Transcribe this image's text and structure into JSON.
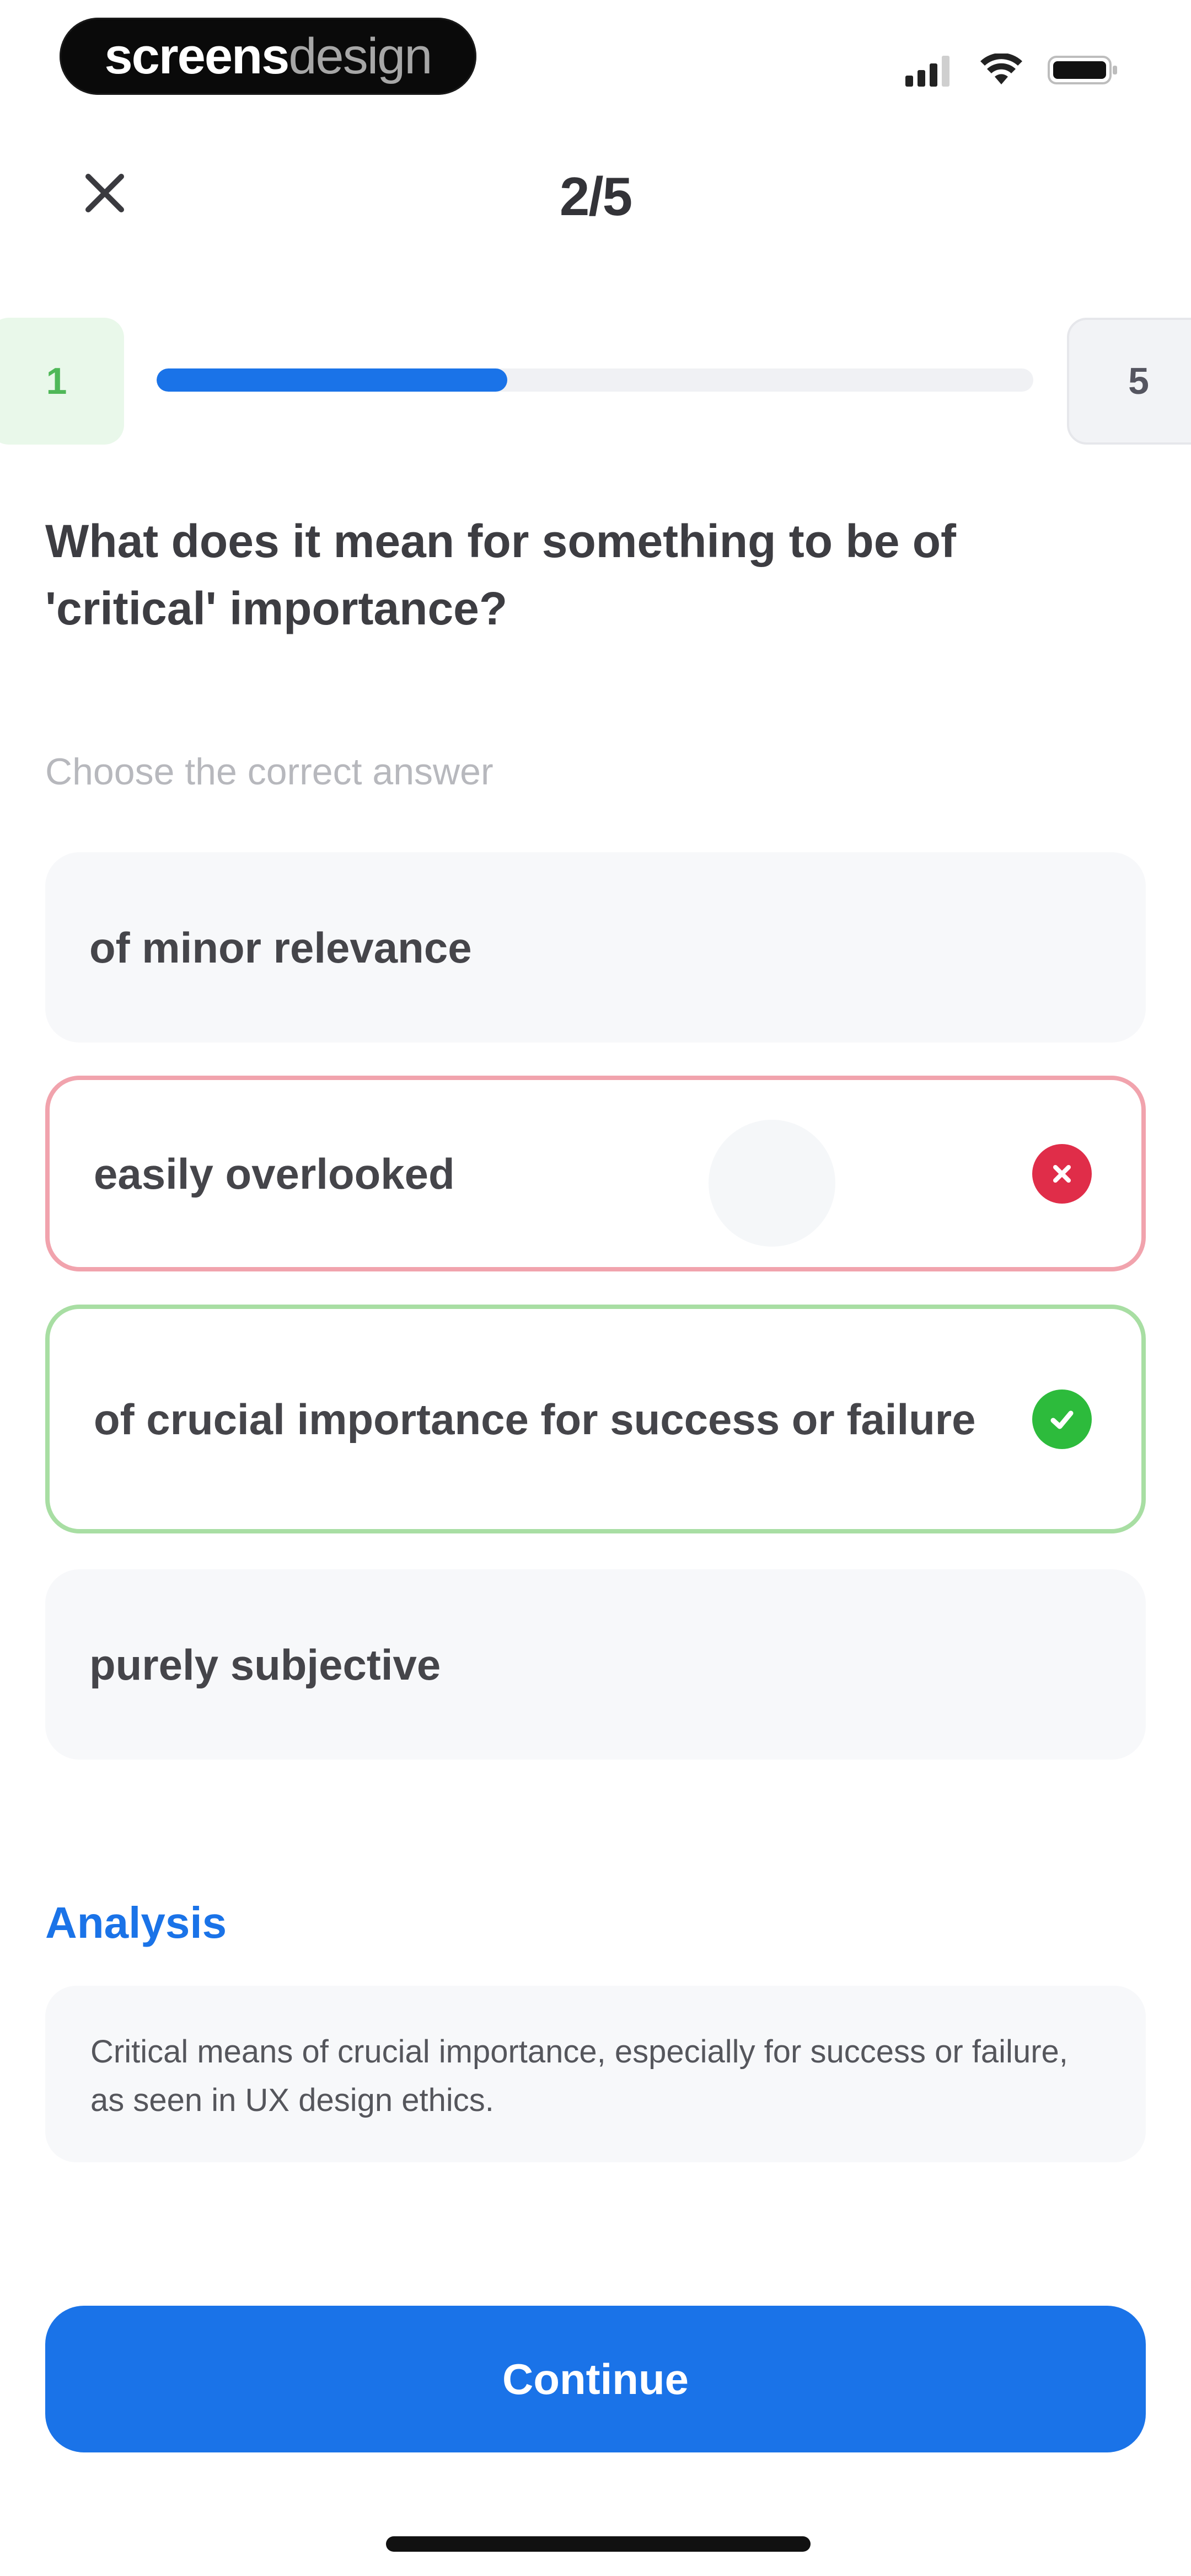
{
  "status_bar": {
    "brand_bold": "screens",
    "brand_light": "design"
  },
  "header": {
    "counter": "2/5"
  },
  "progress": {
    "start_label": "1",
    "end_label": "5",
    "fraction": 0.4
  },
  "question": {
    "text": "What does it mean for something to be of 'critical' importance?",
    "instruction": "Choose the correct answer"
  },
  "options": [
    {
      "label": "of minor relevance",
      "state": "neutral"
    },
    {
      "label": "easily overlooked",
      "state": "wrong"
    },
    {
      "label": "of crucial importance for success or failure",
      "state": "correct"
    },
    {
      "label": "purely subjective",
      "state": "neutral"
    }
  ],
  "analysis": {
    "title": "Analysis",
    "text": "Critical means of crucial importance, especially for success or failure, as seen in UX design ethics."
  },
  "actions": {
    "continue_label": "Continue"
  },
  "colors": {
    "accent": "#1a73e8",
    "correct": "#2dbb3c",
    "wrong": "#e02d49"
  },
  "icons": {
    "close": "close-icon",
    "wrong_badge": "x-circle-icon",
    "correct_badge": "check-circle-icon"
  }
}
